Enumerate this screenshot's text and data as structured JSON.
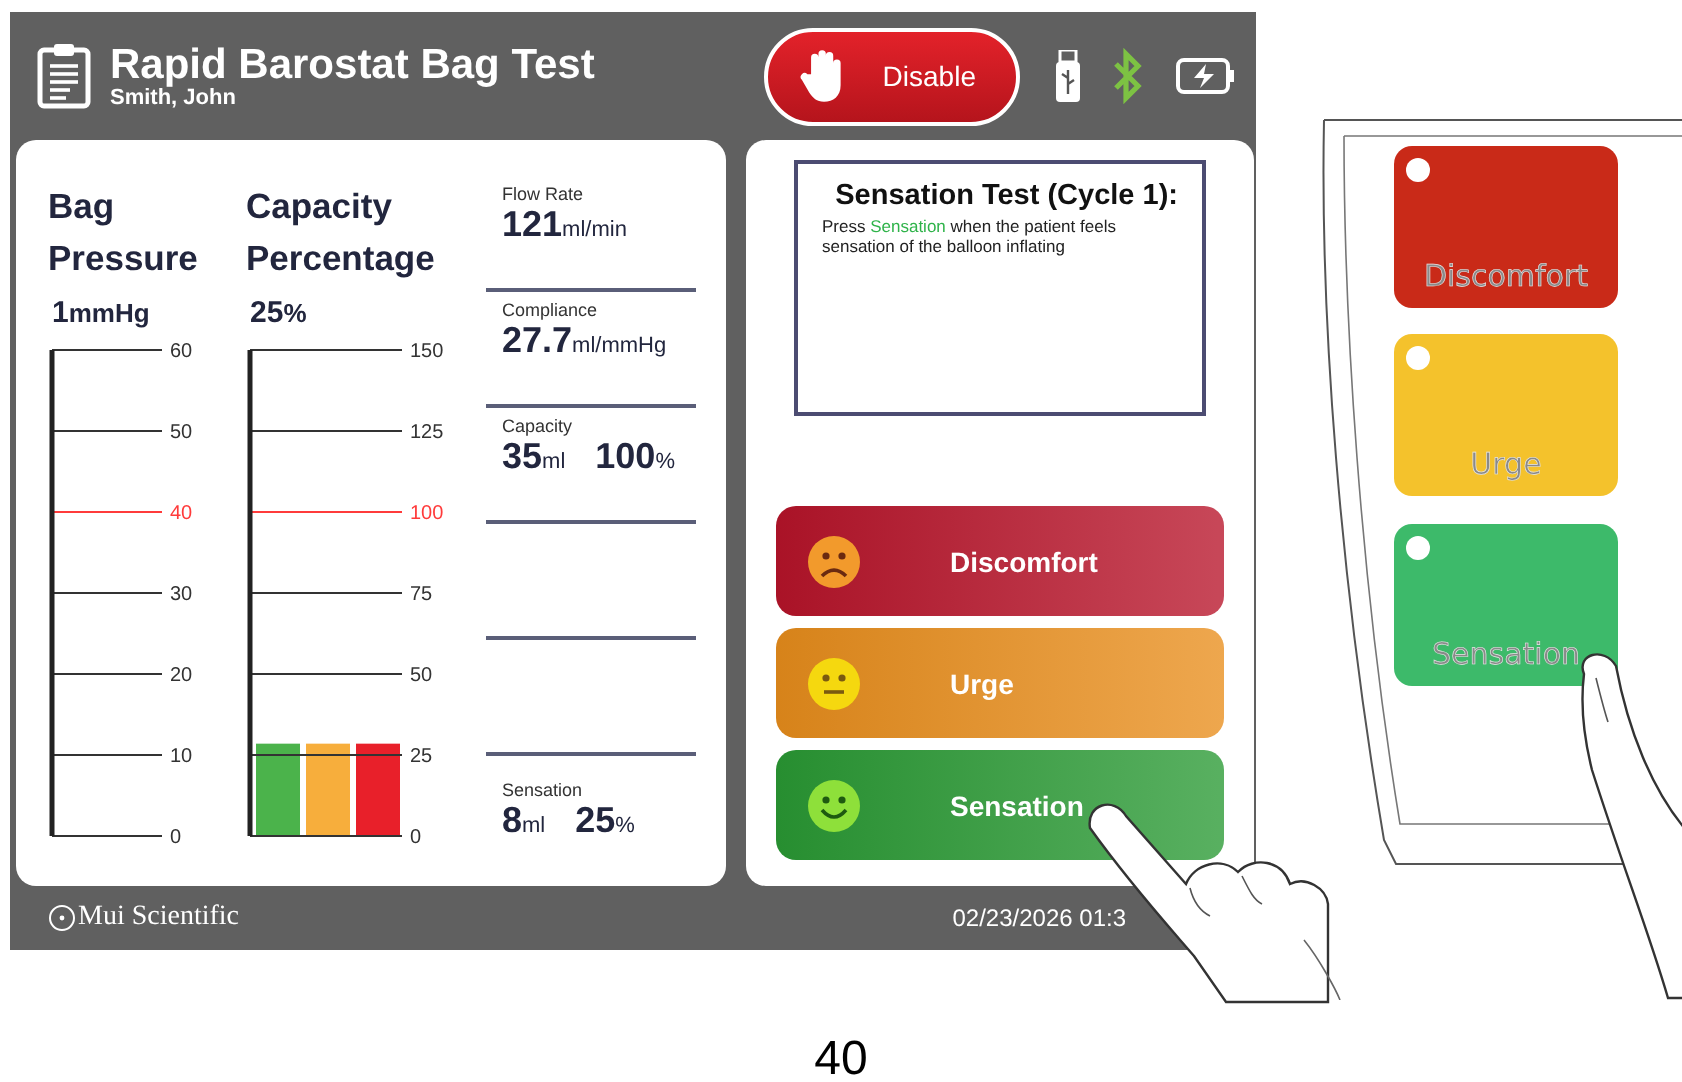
{
  "header": {
    "title": "Rapid Barostat Bag Test",
    "patient": "Smith, John",
    "disable_button": "Disable"
  },
  "gauges": [
    {
      "kind": "scale",
      "title": [
        "Bag",
        "Pressure"
      ],
      "value": "1",
      "unit": "mmHg",
      "scale": [
        {
          "label": "60",
          "limit": false
        },
        {
          "label": "50",
          "limit": false
        },
        {
          "label": "40",
          "limit": true
        },
        {
          "label": "30",
          "limit": false
        },
        {
          "label": "20",
          "limit": false
        },
        {
          "label": "10",
          "limit": false
        },
        {
          "label": "0",
          "limit": false
        }
      ]
    },
    {
      "kind": "scale",
      "title": [
        "Capacity",
        "Percentage"
      ],
      "value": "25",
      "unit": "%",
      "scale": [
        {
          "label": "150",
          "limit": false
        },
        {
          "label": "125",
          "limit": false
        },
        {
          "label": "100",
          "limit": true
        },
        {
          "label": "75",
          "limit": false
        },
        {
          "label": "50",
          "limit": false
        },
        {
          "label": "25",
          "limit": false
        },
        {
          "label": "0",
          "limit": false
        }
      ],
      "bars": [
        {
          "color": "#4bb34b",
          "level": 0.19
        },
        {
          "color": "#f7ae3c",
          "level": 0.19
        },
        {
          "color": "#e8202a",
          "level": 0.19
        }
      ]
    }
  ],
  "stats": [
    {
      "kind": "reading",
      "label": "Flow Rate",
      "values": [
        {
          "value": "121",
          "unit": "ml/min"
        }
      ]
    },
    {
      "kind": "reading",
      "label": "Compliance",
      "values": [
        {
          "value": "27.7",
          "unit": "ml/mmHg"
        }
      ]
    },
    {
      "kind": "reading",
      "label": "Capacity",
      "values": [
        {
          "value": "35",
          "unit": "ml"
        },
        {
          "value": "100",
          "unit": "%"
        }
      ]
    },
    {
      "kind": "blank"
    },
    {
      "kind": "blank"
    },
    {
      "kind": "reading",
      "label": "Sensation",
      "values": [
        {
          "value": "8",
          "unit": "ml"
        },
        {
          "value": "25",
          "unit": "%"
        }
      ]
    }
  ],
  "instruction": {
    "title": "Sensation Test (Cycle 1):",
    "text": "Press **Sensation** when the patient feels sensation of the balloon inflating"
  },
  "responses": [
    {
      "label": "Discomfort",
      "kind": "sad",
      "color": "#b8142a"
    },
    {
      "label": "Urge",
      "kind": "neutral",
      "color": "#e98e1c"
    },
    {
      "label": "Sensation",
      "kind": "happy",
      "color": "#2a9a34"
    }
  ],
  "footer": {
    "brand": "Mui Scientific",
    "datetime": "02/23/2026 01:3"
  },
  "remote_buttons": [
    {
      "label": "Discomfort",
      "color": "#c92a18"
    },
    {
      "label": "Urge",
      "color": "#f4c22c"
    },
    {
      "label": "Sensation",
      "color": "#3dba6a"
    }
  ],
  "page_number": "40"
}
